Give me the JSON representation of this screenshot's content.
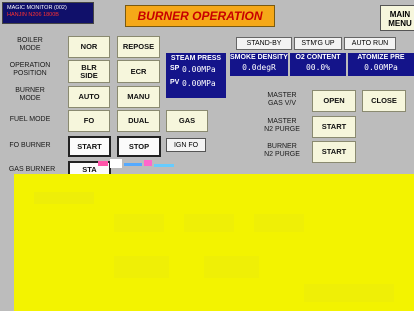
{
  "header": {
    "monitor_line1": "MAGIC MONITOR (002)",
    "monitor_line2": "HANJIN N206 1800B",
    "title": "BURNER OPERATION",
    "main_menu_line1": "MAIN",
    "main_menu_line2": "MENU"
  },
  "rows": {
    "boiler_mode": {
      "label_line1": "BOILER",
      "label_line2": "MODE",
      "opt1": "NOR",
      "opt2": "REPOSE"
    },
    "operation_position": {
      "label_line1": "OPERATION",
      "label_line2": "POSITION",
      "opt1_line1": "BLR",
      "opt1_line2": "SIDE",
      "opt2": "ECR"
    },
    "burner_mode": {
      "label_line1": "BURNER",
      "label_line2": "MODE",
      "opt1": "AUTO",
      "opt2": "MANU"
    },
    "fuel_mode": {
      "label": "FUEL MODE",
      "opt1": "FO",
      "opt2": "DUAL",
      "opt3": "GAS"
    },
    "fo_burner": {
      "label": "FO BURNER",
      "start": "START",
      "stop": "STOP",
      "ign": "IGN FO"
    },
    "gas_burner": {
      "label": "GAS BURNER",
      "start": "STA"
    }
  },
  "steam_press": {
    "title": "STEAM PRESS",
    "sp_label": "SP",
    "sp_value": "0.00MPa",
    "pv_label": "PV",
    "pv_value": "0.00MPa"
  },
  "status_modes": [
    "STAND-BY",
    "STM'G UP",
    "AUTO RUN"
  ],
  "readouts": [
    {
      "title": "SMOKE DENSITY",
      "value": "0.0degR"
    },
    {
      "title": "O2 CONTENT",
      "value": "00.0%"
    },
    {
      "title": "ATOMIZE PRE",
      "value": "0.00MPa"
    }
  ],
  "right_controls": {
    "master_gas": {
      "label_line1": "MASTER",
      "label_line2": "GAS V/V",
      "open": "OPEN",
      "close": "CLOSE"
    },
    "master_n2": {
      "label_line1": "MASTER",
      "label_line2": "N2 PURGE",
      "start": "START"
    },
    "burner_n2": {
      "label_line1": "BURNER",
      "label_line2": "N2 PURGE",
      "start": "START"
    }
  },
  "colors": {
    "background": "#bcbcbc",
    "panel": "#14148a",
    "title_bg": "#f5a818",
    "title_text": "#c80000",
    "button": "#f6f6dc",
    "overlay": "#f3f300"
  }
}
